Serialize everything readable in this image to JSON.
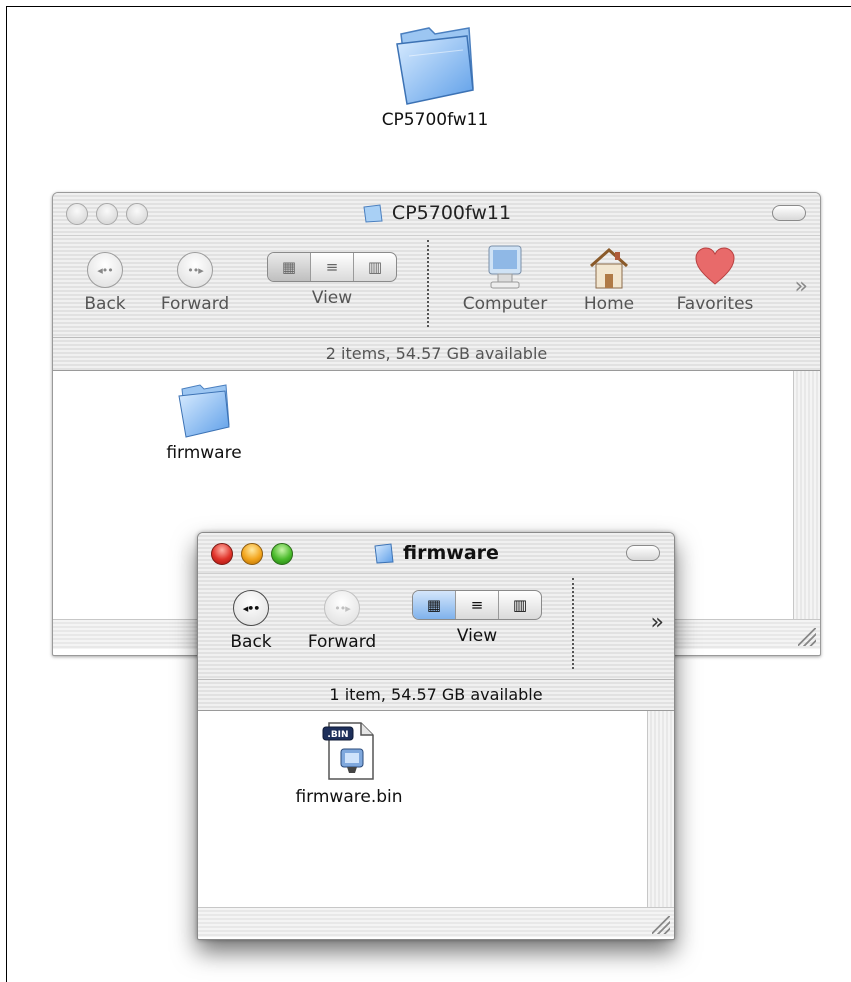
{
  "desktop": {
    "folder": {
      "name": "CP5700fw11",
      "icon": "folder-icon"
    }
  },
  "back_window": {
    "title": "CP5700fw11",
    "title_icon": "folder-icon",
    "toolbar": {
      "back_label": "Back",
      "forward_label": "Forward",
      "view_label": "View",
      "computer_label": "Computer",
      "home_label": "Home",
      "favorites_label": "Favorites",
      "overflow_glyph": "»"
    },
    "status": "2 items, 54.57 GB available",
    "items": [
      {
        "name": "firmware",
        "icon": "folder-icon"
      }
    ]
  },
  "front_window": {
    "title": "firmware",
    "title_icon": "folder-icon",
    "toolbar": {
      "back_label": "Back",
      "forward_label": "Forward",
      "view_label": "View",
      "overflow_glyph": "»"
    },
    "status": "1 item, 54.57 GB available",
    "items": [
      {
        "name": "firmware.bin",
        "icon": "bin-file-icon",
        "badge": ".BIN"
      }
    ]
  },
  "colors": {
    "close": "#e0332a",
    "minimize": "#f3a51d",
    "zoom": "#4bbb2c",
    "selection_blue": "#7fb2ec"
  }
}
